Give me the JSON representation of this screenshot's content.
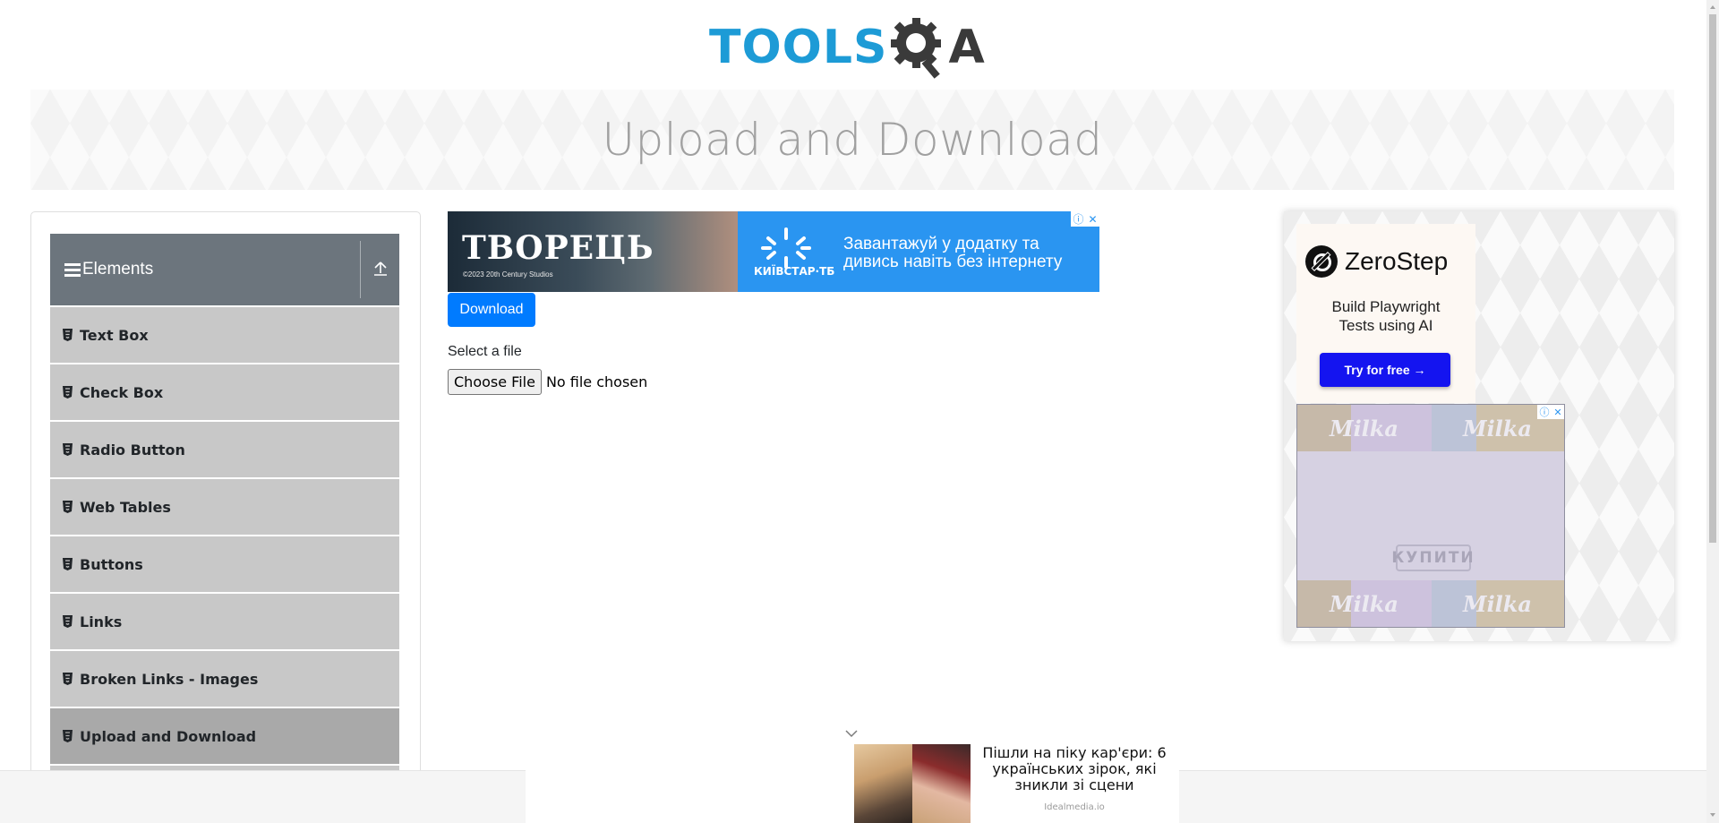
{
  "header": {
    "logo_tools": "TOOLS",
    "logo_qa": "A"
  },
  "banner": {
    "title": "Upload and Download"
  },
  "sidebar": {
    "group_title": "Elements",
    "items": [
      {
        "label": "Text Box"
      },
      {
        "label": "Check Box"
      },
      {
        "label": "Radio Button"
      },
      {
        "label": "Web Tables"
      },
      {
        "label": "Buttons"
      },
      {
        "label": "Links"
      },
      {
        "label": "Broken Links - Images"
      },
      {
        "label": "Upload and Download",
        "active": true
      }
    ]
  },
  "ad_top": {
    "title": "ТВОРЕЦЬ",
    "small": "©2023 20th Century Studios",
    "brand": "КИЇВСТАР·ТБ",
    "copy_line1": "Завантажуй у додатку та",
    "copy_line2": "дивись навіть без інтернету"
  },
  "main": {
    "download_label": "Download",
    "select_label": "Select a file",
    "file_button": "Choose File",
    "file_status": "No file chosen"
  },
  "right_ad": {
    "zerostep_name": "ZeroStep",
    "tag_line1": "Build Playwright",
    "tag_line2": "Tests using AI",
    "cta": "Try for free →",
    "milka_brand": "Milka",
    "milka_buy": "КУПИТИ"
  },
  "native_ad": {
    "text": "Пішли на піку кар'єри: 6 українських зірок, які зникли зі сцени",
    "source": "Idealmedia.io"
  },
  "colors": {
    "accent": "#007bff",
    "sidebar_header": "#6c757d",
    "menu_item": "#c8c8c8",
    "menu_item_active": "#a9a9a9",
    "logo_blue": "#1d9bd6"
  }
}
